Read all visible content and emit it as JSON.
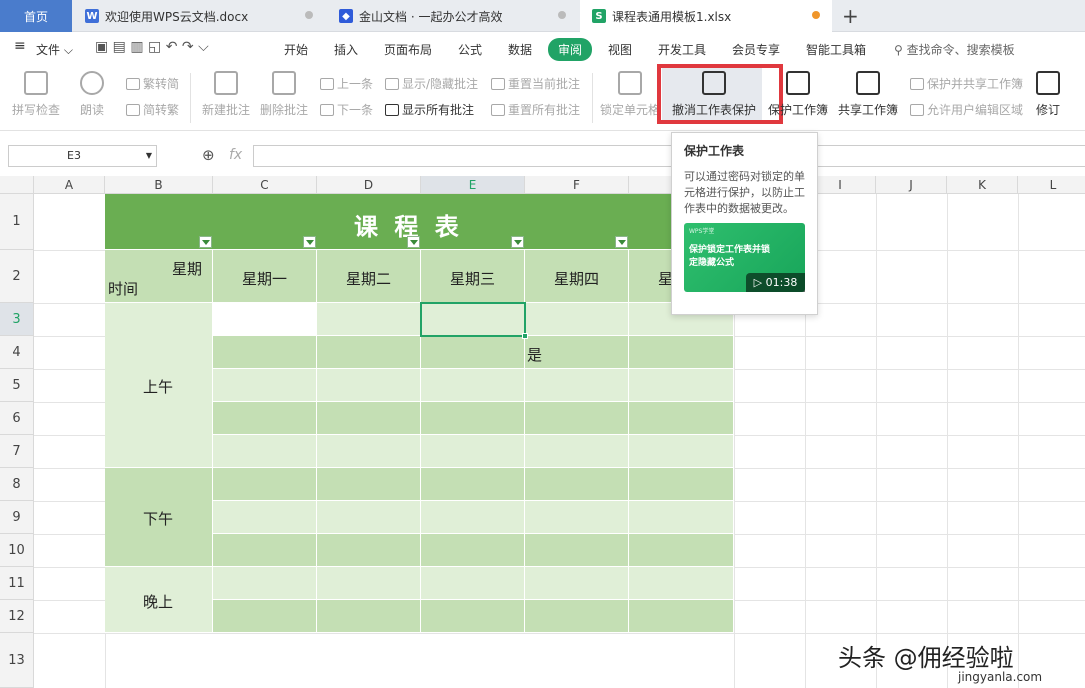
{
  "tabs": [
    {
      "label": "首页",
      "active": true
    },
    {
      "label": "欢迎使用WPS云文档.docx",
      "icon": "W"
    },
    {
      "label": "金山文档 · 一起办公才高效",
      "icon": "◆"
    },
    {
      "label": "课程表通用模板1.xlsx",
      "icon": "S"
    }
  ],
  "new_tab": "+",
  "menu": {
    "file": "文件",
    "items": [
      "开始",
      "插入",
      "页面布局",
      "公式",
      "数据",
      "审阅",
      "视图",
      "开发工具",
      "会员专享",
      "智能工具箱"
    ],
    "active": "审阅",
    "search": "查找命令、搜索模板"
  },
  "toolbar": {
    "spell": "拼写检查",
    "read": "朗读",
    "trad": "繁转简",
    "simp": "简转繁",
    "new_comment": "新建批注",
    "del_comment": "删除批注",
    "prev": "上一条",
    "next": "下一条",
    "show_hide": "显示/隐藏批注",
    "show_all": "显示所有批注",
    "reset_cur": "重置当前批注",
    "reset_all": "重置所有批注",
    "lock_cell": "锁定单元格",
    "unprotect": "撤消工作表保护",
    "protect_wb": "保护工作簿",
    "share_wb": "共享工作簿",
    "protect_share": "保护并共享工作簿",
    "allow_edit": "允许用户编辑区域",
    "revise": "修订"
  },
  "formula": {
    "cell_ref": "E3",
    "fx": "fx"
  },
  "columns": [
    "A",
    "B",
    "C",
    "D",
    "E",
    "F",
    "G",
    "H",
    "I",
    "J",
    "K",
    "L"
  ],
  "rows": [
    "1",
    "2",
    "3",
    "4",
    "5",
    "6",
    "7",
    "8",
    "9",
    "10",
    "11",
    "12",
    "13"
  ],
  "sheet": {
    "title": "课  程  表",
    "corner_top": "星期",
    "corner_bottom": "时间",
    "days": [
      "星期一",
      "星期二",
      "星期三",
      "星期四",
      "星"
    ],
    "periods": [
      "上午",
      "下午",
      "晚上"
    ],
    "f4_value": "是"
  },
  "tooltip": {
    "title": "保护工作表",
    "body": "可以通过密码对锁定的单元格进行保护，以防止工作表中的数据被更改。",
    "card_brand": "WPS学堂",
    "card_title": "保护锁定工作表并锁定隐藏公式",
    "duration": "01:38"
  },
  "watermark": {
    "text": "头条 @佣经验啦",
    "url": "jingyanla.com"
  },
  "colors": {
    "title_green": "#6aae52",
    "header_green": "#c4dfb4",
    "dark_row": "#c4dfb4",
    "light_row": "#e0efd7",
    "highlight_red": "#e0383e",
    "accent_green": "#21a366"
  }
}
